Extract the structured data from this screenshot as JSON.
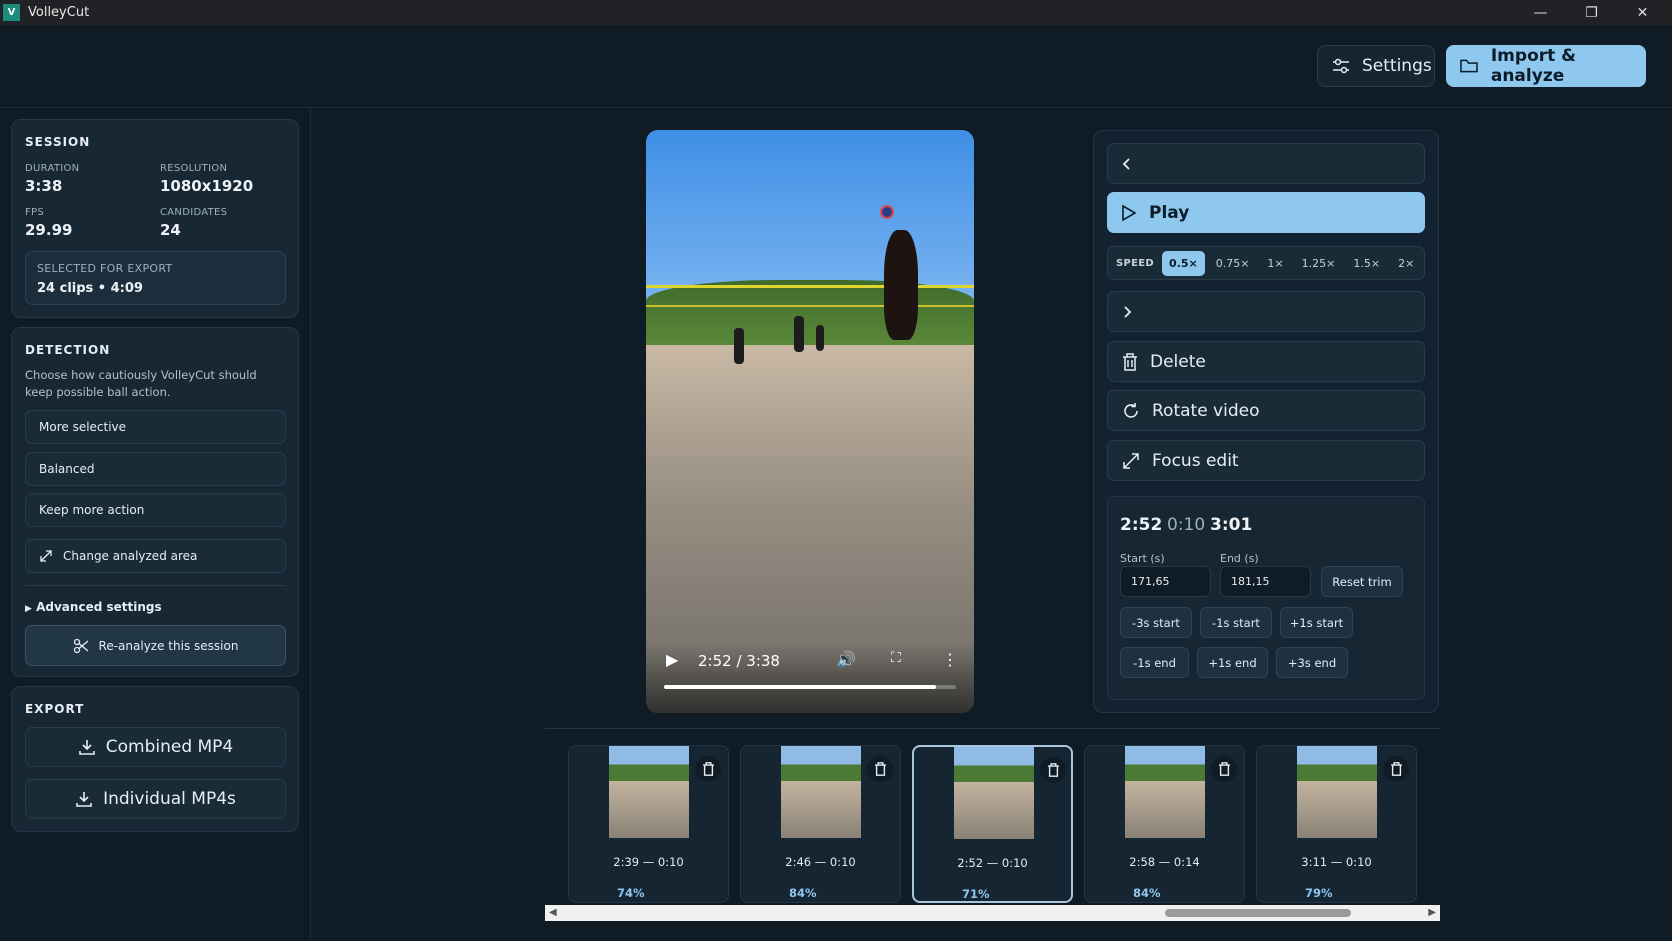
{
  "window": {
    "title": "VolleyCut",
    "logo_letter": "V"
  },
  "toolbar": {
    "settings_label": "Settings",
    "import_label": "Import & analyze"
  },
  "session": {
    "title": "SESSION",
    "duration_label": "DURATION",
    "duration": "3:38",
    "resolution_label": "RESOLUTION",
    "resolution": "1080x1920",
    "fps_label": "FPS",
    "fps": "29.99",
    "candidates_label": "CANDIDATES",
    "candidates": "24",
    "selected_label": "SELECTED FOR EXPORT",
    "selected_value": "24 clips • 4:09"
  },
  "detection": {
    "title": "DETECTION",
    "description": "Choose how cautiously VolleyCut should keep possible ball action.",
    "options": [
      "More selective",
      "Balanced",
      "Keep more action"
    ],
    "change_area_label": "Change analyzed area",
    "advanced_label": "Advanced settings",
    "reanalyze_label": "Re-analyze this session"
  },
  "export": {
    "title": "EXPORT",
    "combined_label": "Combined MP4",
    "individual_label": "Individual MP4s"
  },
  "player": {
    "time": "2:52 / 3:38",
    "progress": 0.93
  },
  "controls": {
    "play_label": "Play",
    "speed_label": "SPEED",
    "speeds": [
      "0.5×",
      "0.75×",
      "1×",
      "1.25×",
      "1.5×",
      "2×"
    ],
    "active_speed": "0.5×",
    "delete_label": "Delete",
    "rotate_label": "Rotate video",
    "focus_label": "Focus edit"
  },
  "trim": {
    "start_time": "2:52",
    "duration": "0:10",
    "end_time": "3:01",
    "start_label": "Start (s)",
    "start_value": "171,65",
    "end_label": "End (s)",
    "end_value": "181,15",
    "reset_label": "Reset trim",
    "buttons_row1": [
      "-3s start",
      "-1s start",
      "+1s start"
    ],
    "buttons_row2": [
      "-1s end",
      "+1s end",
      "+3s end"
    ]
  },
  "clips": [
    {
      "label": "2:39 — 0:10",
      "confidence": "74%"
    },
    {
      "label": "2:46 — 0:10",
      "confidence": "84%"
    },
    {
      "label": "2:52 — 0:10",
      "confidence": "71%",
      "selected": true
    },
    {
      "label": "2:58 — 0:14",
      "confidence": "84%"
    },
    {
      "label": "3:11 — 0:10",
      "confidence": "79%"
    }
  ],
  "colors": {
    "accent": "#8ec8ef",
    "background": "#0f1c26",
    "card": "#172734"
  }
}
